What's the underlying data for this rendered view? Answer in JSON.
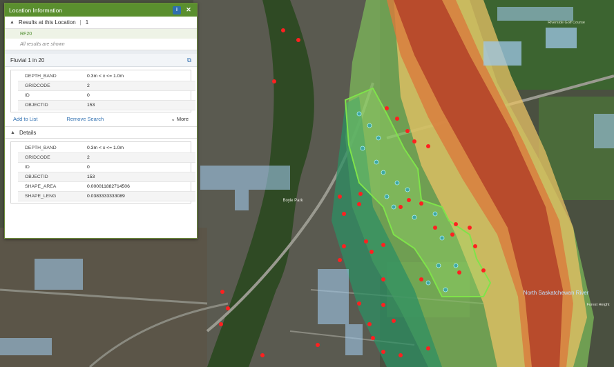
{
  "panel": {
    "title": "Location Information",
    "info_icon": "i",
    "close_icon": "✕",
    "results_header": "Results at this Location",
    "results_count": "1",
    "result_name": "RF20",
    "results_note": "All results are shown",
    "layer_title": "Fluvial 1 in 20",
    "summary_rows": [
      {
        "key": "DEPTH_BAND",
        "value": "0.3m < x <= 1.0m"
      },
      {
        "key": "GRIDCODE",
        "value": "2"
      },
      {
        "key": "ID",
        "value": "0"
      },
      {
        "key": "OBJECTID",
        "value": "153"
      }
    ],
    "add_to_list": "Add to List",
    "remove_search": "Remove Search",
    "more": "More",
    "details_header": "Details",
    "detail_rows": [
      {
        "key": "DEPTH_BAND",
        "value": "0.3m < x <= 1.0m"
      },
      {
        "key": "GRIDCODE",
        "value": "2"
      },
      {
        "key": "ID",
        "value": "0"
      },
      {
        "key": "OBJECTID",
        "value": "153"
      },
      {
        "key": "SHAPE_AREA",
        "value": "0.000011882714506"
      },
      {
        "key": "SHAPE_LENG",
        "value": "0.0383333333089"
      }
    ]
  },
  "map": {
    "labels": {
      "river": "North Saskatchewan River",
      "golf": "Riverside Golf Course",
      "park": "Boyle Park",
      "forest": "Forest Height"
    }
  },
  "colors": {
    "titlebar": "#5a8f2e",
    "link": "#2f6fb0",
    "flood_deep": "#b5452a",
    "flood_mid": "#d97a3c",
    "flood_shallow": "#e8c266",
    "flood_green": "#7fbf5a",
    "flood_teal": "#2e8f63",
    "selection": "#7fe34a",
    "points": "#ff2020"
  }
}
